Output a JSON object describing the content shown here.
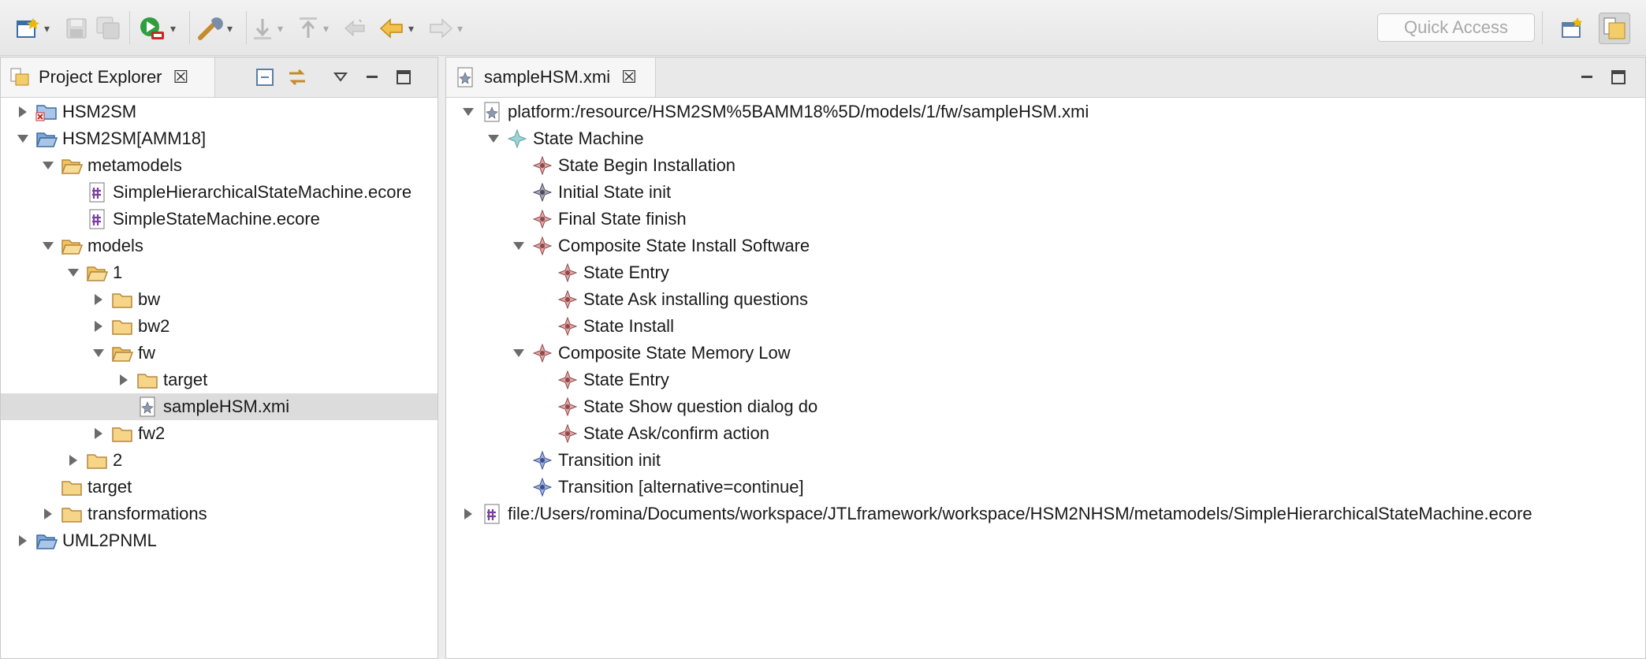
{
  "toolbar": {
    "quick_access": "Quick Access"
  },
  "project_explorer": {
    "title": "Project Explorer",
    "tree": [
      {
        "label": "HSM2SM",
        "depth": 0,
        "twisty": "closed",
        "icon": "project-closed-icon"
      },
      {
        "label": "HSM2SM[AMM18]",
        "depth": 0,
        "twisty": "open",
        "icon": "project-open-icon"
      },
      {
        "label": "metamodels",
        "depth": 1,
        "twisty": "open",
        "icon": "folder-open-icon"
      },
      {
        "label": "SimpleHierarchicalStateMachine.ecore",
        "depth": 2,
        "twisty": "none",
        "icon": "ecore-file-icon"
      },
      {
        "label": "SimpleStateMachine.ecore",
        "depth": 2,
        "twisty": "none",
        "icon": "ecore-file-icon"
      },
      {
        "label": "models",
        "depth": 1,
        "twisty": "open",
        "icon": "folder-open-icon"
      },
      {
        "label": "1",
        "depth": 2,
        "twisty": "open",
        "icon": "folder-open-icon"
      },
      {
        "label": "bw",
        "depth": 3,
        "twisty": "closed",
        "icon": "folder-icon"
      },
      {
        "label": "bw2",
        "depth": 3,
        "twisty": "closed",
        "icon": "folder-icon"
      },
      {
        "label": "fw",
        "depth": 3,
        "twisty": "open",
        "icon": "folder-open-icon"
      },
      {
        "label": "target",
        "depth": 4,
        "twisty": "closed",
        "icon": "folder-icon"
      },
      {
        "label": "sampleHSM.xmi",
        "depth": 4,
        "twisty": "none",
        "icon": "xmi-file-icon",
        "selected": true
      },
      {
        "label": "fw2",
        "depth": 3,
        "twisty": "closed",
        "icon": "folder-icon"
      },
      {
        "label": "2",
        "depth": 2,
        "twisty": "closed",
        "icon": "folder-icon"
      },
      {
        "label": "target",
        "depth": 1,
        "twisty": "none",
        "icon": "folder-icon"
      },
      {
        "label": "transformations",
        "depth": 1,
        "twisty": "closed",
        "icon": "folder-icon"
      },
      {
        "label": "UML2PNML",
        "depth": 0,
        "twisty": "closed",
        "icon": "project-open-icon"
      }
    ]
  },
  "editor": {
    "tab_title": "sampleHSM.xmi",
    "tree": [
      {
        "label": "platform:/resource/HSM2SM%5BAMM18%5D/models/1/fw/sampleHSM.xmi",
        "depth": 0,
        "twisty": "open",
        "icon": "xmi-file-icon"
      },
      {
        "label": "State Machine",
        "depth": 1,
        "twisty": "open",
        "icon": "state-machine-icon"
      },
      {
        "label": "State Begin Installation",
        "depth": 2,
        "twisty": "none",
        "icon": "state-icon"
      },
      {
        "label": "Initial State init",
        "depth": 2,
        "twisty": "none",
        "icon": "initial-state-icon"
      },
      {
        "label": "Final State finish",
        "depth": 2,
        "twisty": "none",
        "icon": "state-icon"
      },
      {
        "label": "Composite State Install Software",
        "depth": 2,
        "twisty": "open",
        "icon": "state-icon"
      },
      {
        "label": "State Entry",
        "depth": 3,
        "twisty": "none",
        "icon": "state-icon"
      },
      {
        "label": "State Ask installing questions",
        "depth": 3,
        "twisty": "none",
        "icon": "state-icon"
      },
      {
        "label": "State Install",
        "depth": 3,
        "twisty": "none",
        "icon": "state-icon"
      },
      {
        "label": "Composite State Memory Low",
        "depth": 2,
        "twisty": "open",
        "icon": "state-icon"
      },
      {
        "label": "State Entry",
        "depth": 3,
        "twisty": "none",
        "icon": "state-icon"
      },
      {
        "label": "State Show question dialog do",
        "depth": 3,
        "twisty": "none",
        "icon": "state-icon"
      },
      {
        "label": "State Ask/confirm action",
        "depth": 3,
        "twisty": "none",
        "icon": "state-icon"
      },
      {
        "label": "Transition init",
        "depth": 2,
        "twisty": "none",
        "icon": "transition-icon"
      },
      {
        "label": "Transition [alternative=continue]",
        "depth": 2,
        "twisty": "none",
        "icon": "transition-icon"
      },
      {
        "label": "file:/Users/romina/Documents/workspace/JTLframework/workspace/HSM2NHSM/metamodels/SimpleHierarchicalStateMachine.ecore",
        "depth": 0,
        "twisty": "closed",
        "icon": "ecore-file-icon"
      }
    ]
  }
}
